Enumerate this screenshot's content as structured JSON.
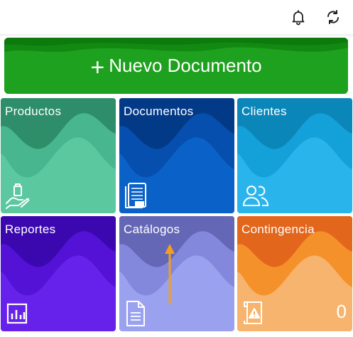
{
  "header": {
    "notification_icon": "bell-icon",
    "sync_icon": "sync-icon"
  },
  "new_document": {
    "plus": "+",
    "label": "Nuevo Documento",
    "color": "#1a9a1a"
  },
  "tiles": [
    {
      "title": "Productos",
      "icon": "hand-bag-icon",
      "base": "#5cc8a0",
      "wave1": "#48b68e",
      "wave2": "#2e8e6a"
    },
    {
      "title": "Documentos",
      "icon": "xml-document-icon",
      "base": "#0a62c8",
      "wave1": "#074fae",
      "wave2": "#033a88"
    },
    {
      "title": "Clientes",
      "icon": "users-icon",
      "base": "#2ab4ec",
      "wave1": "#14a0d8",
      "wave2": "#0b86b8"
    },
    {
      "title": "Reportes",
      "icon": "bar-chart-icon",
      "base": "#6622ea",
      "wave1": "#5312d6",
      "wave2": "#3b08b0"
    },
    {
      "title": "Catálogos",
      "icon": "document-icon",
      "base": "#9aa2f0",
      "wave1": "#8388dc",
      "wave2": "#6466b6"
    },
    {
      "title": "Contingencia",
      "icon": "warning-scroll-icon",
      "base": "#f7b46e",
      "wave1": "#f5912a",
      "wave2": "#e2661c",
      "count": "0"
    }
  ]
}
